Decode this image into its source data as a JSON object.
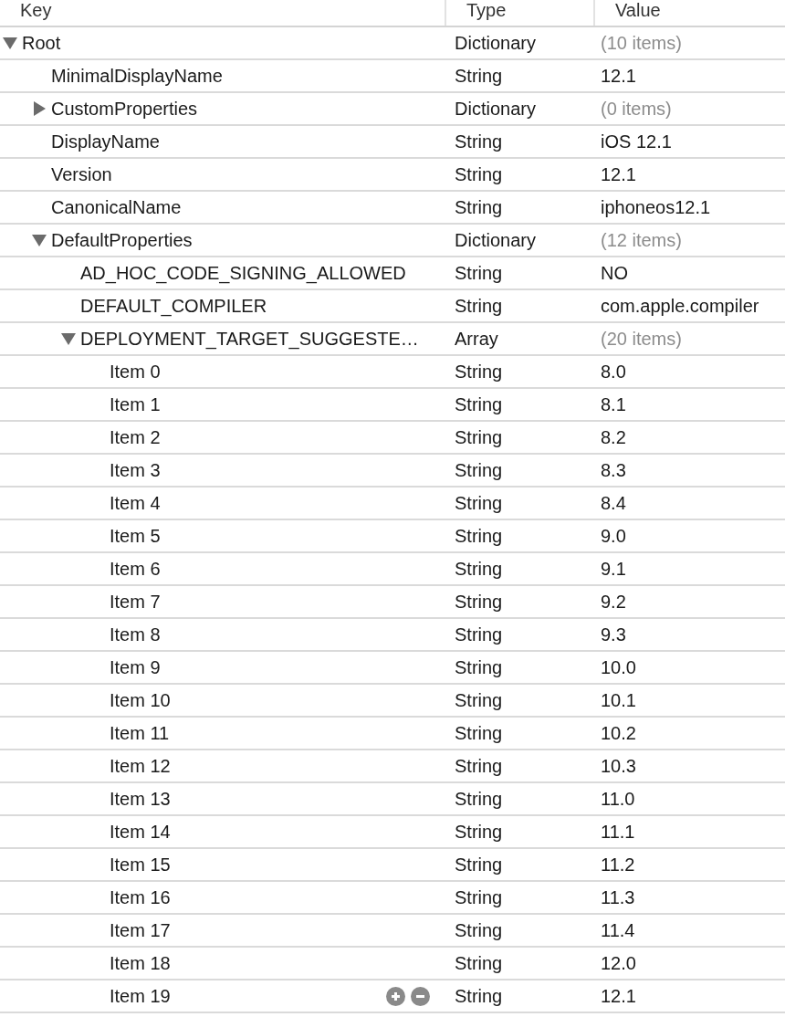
{
  "columns": [
    "Key",
    "Type",
    "Value"
  ],
  "rows": [
    {
      "key": "Root",
      "type": "Dictionary",
      "value": "(10 items)",
      "expanded": true,
      "hovered": false,
      "children": [
        {
          "key": "MinimalDisplayName",
          "type": "String",
          "value": "12.1",
          "hovered": false
        },
        {
          "key": "CustomProperties",
          "type": "Dictionary",
          "value": "(0 items)",
          "expanded": false,
          "hovered": false
        },
        {
          "key": "DisplayName",
          "type": "String",
          "value": "iOS 12.1",
          "hovered": false
        },
        {
          "key": "Version",
          "type": "String",
          "value": "12.1",
          "hovered": false
        },
        {
          "key": "CanonicalName",
          "type": "String",
          "value": "iphoneos12.1",
          "hovered": false
        },
        {
          "key": "DefaultProperties",
          "type": "Dictionary",
          "value": "(12 items)",
          "expanded": true,
          "hovered": false,
          "children": [
            {
              "key": "AD_HOC_CODE_SIGNING_ALLOWED",
              "type": "String",
              "value": "NO",
              "hovered": false
            },
            {
              "key": "DEFAULT_COMPILER",
              "type": "String",
              "value": "com.apple.compiler",
              "hovered": false
            },
            {
              "key": "DEPLOYMENT_TARGET_SUGGESTE…",
              "type": "Array",
              "value": "(20 items)",
              "expanded": true,
              "hovered": false,
              "children": [
                {
                  "key": "Item 0",
                  "type": "String",
                  "value": "8.0",
                  "hovered": false
                },
                {
                  "key": "Item 1",
                  "type": "String",
                  "value": "8.1",
                  "hovered": false
                },
                {
                  "key": "Item 2",
                  "type": "String",
                  "value": "8.2",
                  "hovered": false
                },
                {
                  "key": "Item 3",
                  "type": "String",
                  "value": "8.3",
                  "hovered": false
                },
                {
                  "key": "Item 4",
                  "type": "String",
                  "value": "8.4",
                  "hovered": false
                },
                {
                  "key": "Item 5",
                  "type": "String",
                  "value": "9.0",
                  "hovered": false
                },
                {
                  "key": "Item 6",
                  "type": "String",
                  "value": "9.1",
                  "hovered": false
                },
                {
                  "key": "Item 7",
                  "type": "String",
                  "value": "9.2",
                  "hovered": false
                },
                {
                  "key": "Item 8",
                  "type": "String",
                  "value": "9.3",
                  "hovered": false
                },
                {
                  "key": "Item 9",
                  "type": "String",
                  "value": "10.0",
                  "hovered": false
                },
                {
                  "key": "Item 10",
                  "type": "String",
                  "value": "10.1",
                  "hovered": false
                },
                {
                  "key": "Item 11",
                  "type": "String",
                  "value": "10.2",
                  "hovered": false
                },
                {
                  "key": "Item 12",
                  "type": "String",
                  "value": "10.3",
                  "hovered": false
                },
                {
                  "key": "Item 13",
                  "type": "String",
                  "value": "11.0",
                  "hovered": false
                },
                {
                  "key": "Item 14",
                  "type": "String",
                  "value": "11.1",
                  "hovered": false
                },
                {
                  "key": "Item 15",
                  "type": "String",
                  "value": "11.2",
                  "hovered": false
                },
                {
                  "key": "Item 16",
                  "type": "String",
                  "value": "11.3",
                  "hovered": false
                },
                {
                  "key": "Item 17",
                  "type": "String",
                  "value": "11.4",
                  "hovered": false
                },
                {
                  "key": "Item 18",
                  "type": "String",
                  "value": "12.0",
                  "hovered": false
                },
                {
                  "key": "Item 19",
                  "type": "String",
                  "value": "12.1",
                  "hovered": true
                }
              ]
            }
          ]
        }
      ]
    }
  ]
}
